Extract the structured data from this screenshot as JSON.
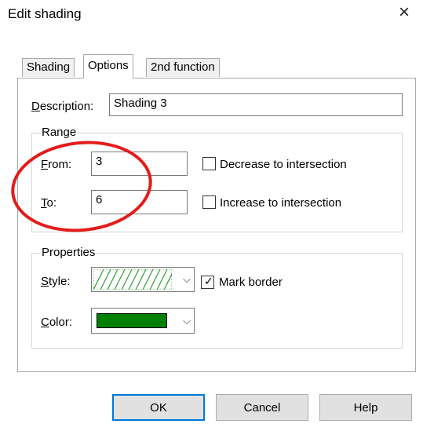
{
  "window": {
    "title": "Edit shading",
    "close_icon": "×"
  },
  "tabs": [
    {
      "label": "Shading"
    },
    {
      "label": "Options"
    },
    {
      "label": "2nd function"
    }
  ],
  "description": {
    "label": "Description:",
    "value": "Shading 3"
  },
  "range": {
    "group_label": "Range",
    "from": {
      "label": "From:",
      "value": "3"
    },
    "to": {
      "label": "To:",
      "value": "6"
    },
    "decrease": {
      "label": "Decrease to intersection",
      "checked": false
    },
    "increase": {
      "label": "Increase to intersection",
      "checked": false
    }
  },
  "properties": {
    "group_label": "Properties",
    "style": {
      "label": "Style:",
      "pattern": "green-diagonal-hatch",
      "pattern_color": "#2e9e2e"
    },
    "mark_border": {
      "label": "Mark border",
      "checked": true,
      "glyph": "✓"
    },
    "color": {
      "label": "Color:",
      "value": "#008000"
    },
    "dropdown_glyph": "⌵"
  },
  "buttons": {
    "ok": "OK",
    "cancel": "Cancel",
    "help": "Help"
  },
  "annotation": {
    "color": "#e41b1b"
  }
}
